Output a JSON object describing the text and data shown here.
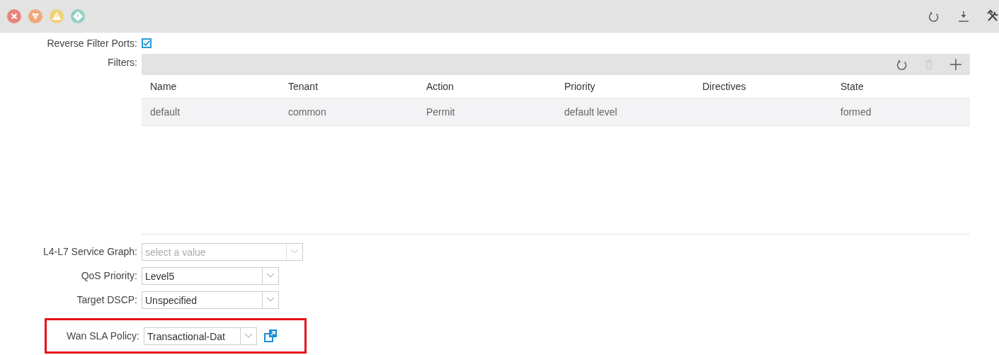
{
  "toolbar": {
    "status_icons": [
      {
        "kind": "critical",
        "color": "#e8847a"
      },
      {
        "kind": "major",
        "color": "#f0a878"
      },
      {
        "kind": "minor",
        "color": "#f2d27a"
      },
      {
        "kind": "warning",
        "color": "#8fd0c4"
      }
    ]
  },
  "reverse_filter_ports": {
    "label": "Reverse Filter Ports:",
    "checked": true
  },
  "filters": {
    "label": "Filters:",
    "columns": [
      "Name",
      "Tenant",
      "Action",
      "Priority",
      "Directives",
      "State"
    ],
    "rows": [
      {
        "cells": [
          "default",
          "common",
          "Permit",
          "default level",
          "",
          "formed"
        ]
      }
    ]
  },
  "fields": [
    {
      "label": "L4-L7 Service Graph:",
      "placeholder": "select a value",
      "disabled": true
    },
    {
      "label": "QoS Priority:",
      "value": "Level5",
      "disabled": false
    },
    {
      "label": "Target DSCP:",
      "value": "Unspecified",
      "disabled": false
    },
    {
      "label": "Wan SLA Policy:",
      "value": "Transactional-Dat",
      "disabled": false,
      "highlighted": true,
      "link_icon": true
    }
  ]
}
